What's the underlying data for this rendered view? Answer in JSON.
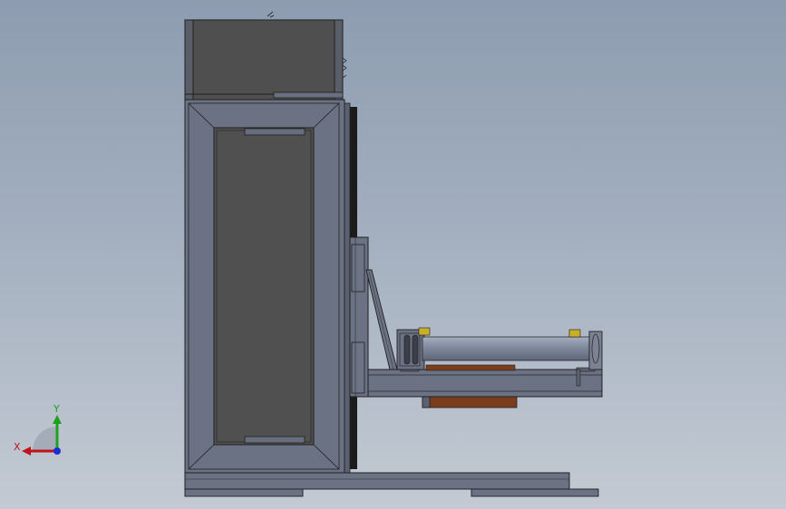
{
  "viewport": {
    "background_top": "#8d9cb0",
    "background_bottom": "#c3cad3"
  },
  "triad": {
    "x_label": "X",
    "y_label": "Y",
    "x_color": "#c0141c",
    "y_color": "#1fa01f",
    "z_color": "#1a2fd0"
  },
  "model": {
    "frame_color": "#6a7284",
    "panel_color": "#4e4e4e",
    "roller_color": "#7c8698",
    "belt_color": "#7a3e1e",
    "accent_color": "#c8b02a"
  }
}
